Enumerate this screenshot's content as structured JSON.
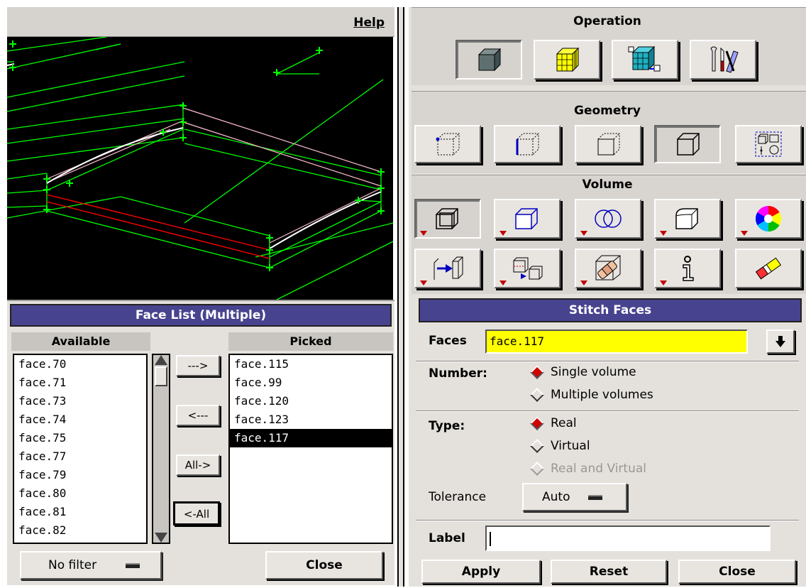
{
  "menubar": {
    "help_label": "Help"
  },
  "face_list": {
    "title": "Face List (Multiple)",
    "available_header": "Available",
    "picked_header": "Picked",
    "available_items": [
      "face.70",
      "face.71",
      "face.73",
      "face.74",
      "face.75",
      "face.77",
      "face.79",
      "face.80",
      "face.81",
      "face.82"
    ],
    "picked_items": [
      "face.115",
      "face.99",
      "face.120",
      "face.123",
      "face.117"
    ],
    "picked_selected": "face.117",
    "move_right_label": "--->",
    "move_left_label": "<---",
    "all_right_label": "All->",
    "all_left_label": "<-All",
    "filter_value": "No filter",
    "close_label": "Close"
  },
  "operation": {
    "title": "Operation",
    "tools": [
      "solid-cube-icon",
      "mesh-grid-icon",
      "zones-icon",
      "tools-icon"
    ],
    "active_index": 0
  },
  "geometry": {
    "title": "Geometry",
    "tools": [
      "vertex-icon",
      "edge-icon",
      "face-icon",
      "volume-icon",
      "group-icon"
    ],
    "active_index": 3
  },
  "volume": {
    "title": "Volume",
    "tools_row1": [
      "create-volume-icon",
      "move-volume-icon",
      "boolean-volume-icon",
      "blend-volume-icon",
      "color-wheel-icon"
    ],
    "tools_row2": [
      "split-volume-icon",
      "merge-volume-icon",
      "stitch-faces-icon",
      "info-icon",
      "erase-icon"
    ],
    "active_index": 0
  },
  "stitch_faces": {
    "title": "Stitch Faces",
    "faces_label": "Faces",
    "faces_value": "face.117",
    "number_label": "Number:",
    "number_options": [
      "Single volume",
      "Multiple volumes"
    ],
    "number_selected": "Single volume",
    "type_label": "Type:",
    "type_options": [
      "Real",
      "Virtual",
      "Real and Virtual"
    ],
    "type_selected": "Real",
    "type_disabled": "Real and Virtual",
    "tolerance_label": "Tolerance",
    "tolerance_value": "Auto",
    "label_label": "Label",
    "label_value": "",
    "apply_label": "Apply",
    "reset_label": "Reset",
    "close_label": "Close"
  },
  "colors": {
    "title_bar": "#48438e",
    "faces_field_bg": "#ffff00",
    "radio_on": "#d00000",
    "viewport_bg": "#000000",
    "wire_green": "#00ff00",
    "wire_pink": "#ffc0d0",
    "wire_red": "#ff0000"
  }
}
